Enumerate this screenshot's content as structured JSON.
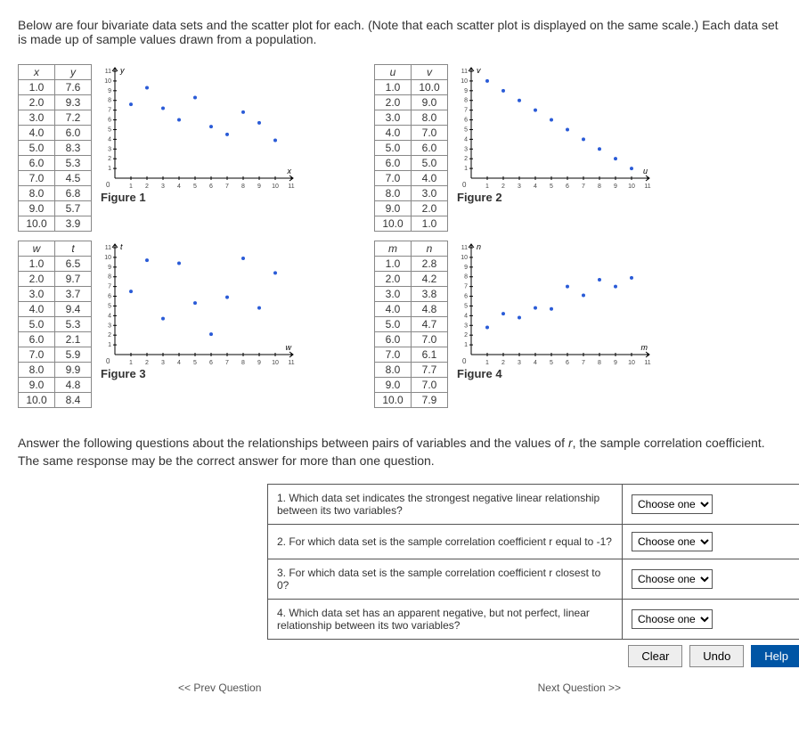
{
  "intro": "Below are four bivariate data sets and the scatter plot for each. (Note that each scatter plot is displayed on the same scale.) Each data set is made up of sample values drawn from a population.",
  "dropdown_placeholder": "Choose one",
  "panels": [
    {
      "hx": "x",
      "hy": "y",
      "caption": "Figure 1",
      "rows": [
        [
          "1.0",
          "7.6"
        ],
        [
          "2.0",
          "9.3"
        ],
        [
          "3.0",
          "7.2"
        ],
        [
          "4.0",
          "6.0"
        ],
        [
          "5.0",
          "8.3"
        ],
        [
          "6.0",
          "5.3"
        ],
        [
          "7.0",
          "4.5"
        ],
        [
          "8.0",
          "6.8"
        ],
        [
          "9.0",
          "5.7"
        ],
        [
          "10.0",
          "3.9"
        ]
      ]
    },
    {
      "hx": "u",
      "hy": "v",
      "caption": "Figure 2",
      "rows": [
        [
          "1.0",
          "10.0"
        ],
        [
          "2.0",
          "9.0"
        ],
        [
          "3.0",
          "8.0"
        ],
        [
          "4.0",
          "7.0"
        ],
        [
          "5.0",
          "6.0"
        ],
        [
          "6.0",
          "5.0"
        ],
        [
          "7.0",
          "4.0"
        ],
        [
          "8.0",
          "3.0"
        ],
        [
          "9.0",
          "2.0"
        ],
        [
          "10.0",
          "1.0"
        ]
      ]
    },
    {
      "hx": "w",
      "hy": "t",
      "caption": "Figure 3",
      "rows": [
        [
          "1.0",
          "6.5"
        ],
        [
          "2.0",
          "9.7"
        ],
        [
          "3.0",
          "3.7"
        ],
        [
          "4.0",
          "9.4"
        ],
        [
          "5.0",
          "5.3"
        ],
        [
          "6.0",
          "2.1"
        ],
        [
          "7.0",
          "5.9"
        ],
        [
          "8.0",
          "9.9"
        ],
        [
          "9.0",
          "4.8"
        ],
        [
          "10.0",
          "8.4"
        ]
      ]
    },
    {
      "hx": "m",
      "hy": "n",
      "caption": "Figure 4",
      "rows": [
        [
          "1.0",
          "2.8"
        ],
        [
          "2.0",
          "4.2"
        ],
        [
          "3.0",
          "3.8"
        ],
        [
          "4.0",
          "4.8"
        ],
        [
          "5.0",
          "4.7"
        ],
        [
          "6.0",
          "7.0"
        ],
        [
          "7.0",
          "6.1"
        ],
        [
          "8.0",
          "7.7"
        ],
        [
          "9.0",
          "7.0"
        ],
        [
          "10.0",
          "7.9"
        ]
      ]
    }
  ],
  "qintro_html": "Answer the following questions about the relationships between pairs of variables and the values of <i>r</i>, the sample correlation coefficient. The same response may be the correct answer for more than one question.",
  "questions": [
    "1. Which data set indicates the strongest negative linear relationship between its two variables?",
    "2. For which data set is the sample correlation coefficient r equal to -1?",
    "3. For which data set is the sample correlation coefficient r closest to 0?",
    "4. Which data set has an apparent negative, but not perfect, linear relationship between its two variables?"
  ],
  "buttons": {
    "clear": "Clear",
    "undo": "Undo",
    "help": "Help"
  },
  "nav": {
    "prev": "<< Prev Question",
    "next": "Next Question >>"
  },
  "chart_data": [
    {
      "type": "scatter",
      "xlabel": "x",
      "ylabel": "y",
      "xlim": [
        0,
        11
      ],
      "ylim": [
        0,
        11
      ],
      "title": "Figure 1",
      "x": [
        1,
        2,
        3,
        4,
        5,
        6,
        7,
        8,
        9,
        10
      ],
      "y": [
        7.6,
        9.3,
        7.2,
        6.0,
        8.3,
        5.3,
        4.5,
        6.8,
        5.7,
        3.9
      ]
    },
    {
      "type": "scatter",
      "xlabel": "u",
      "ylabel": "v",
      "xlim": [
        0,
        11
      ],
      "ylim": [
        0,
        11
      ],
      "title": "Figure 2",
      "x": [
        1,
        2,
        3,
        4,
        5,
        6,
        7,
        8,
        9,
        10
      ],
      "y": [
        10.0,
        9.0,
        8.0,
        7.0,
        6.0,
        5.0,
        4.0,
        3.0,
        2.0,
        1.0
      ]
    },
    {
      "type": "scatter",
      "xlabel": "w",
      "ylabel": "t",
      "xlim": [
        0,
        11
      ],
      "ylim": [
        0,
        11
      ],
      "title": "Figure 3",
      "x": [
        1,
        2,
        3,
        4,
        5,
        6,
        7,
        8,
        9,
        10
      ],
      "y": [
        6.5,
        9.7,
        3.7,
        9.4,
        5.3,
        2.1,
        5.9,
        9.9,
        4.8,
        8.4
      ]
    },
    {
      "type": "scatter",
      "xlabel": "m",
      "ylabel": "n",
      "xlim": [
        0,
        11
      ],
      "ylim": [
        0,
        11
      ],
      "title": "Figure 4",
      "x": [
        1,
        2,
        3,
        4,
        5,
        6,
        7,
        8,
        9,
        10
      ],
      "y": [
        2.8,
        4.2,
        3.8,
        4.8,
        4.7,
        7.0,
        6.1,
        7.7,
        7.0,
        7.9
      ]
    }
  ]
}
